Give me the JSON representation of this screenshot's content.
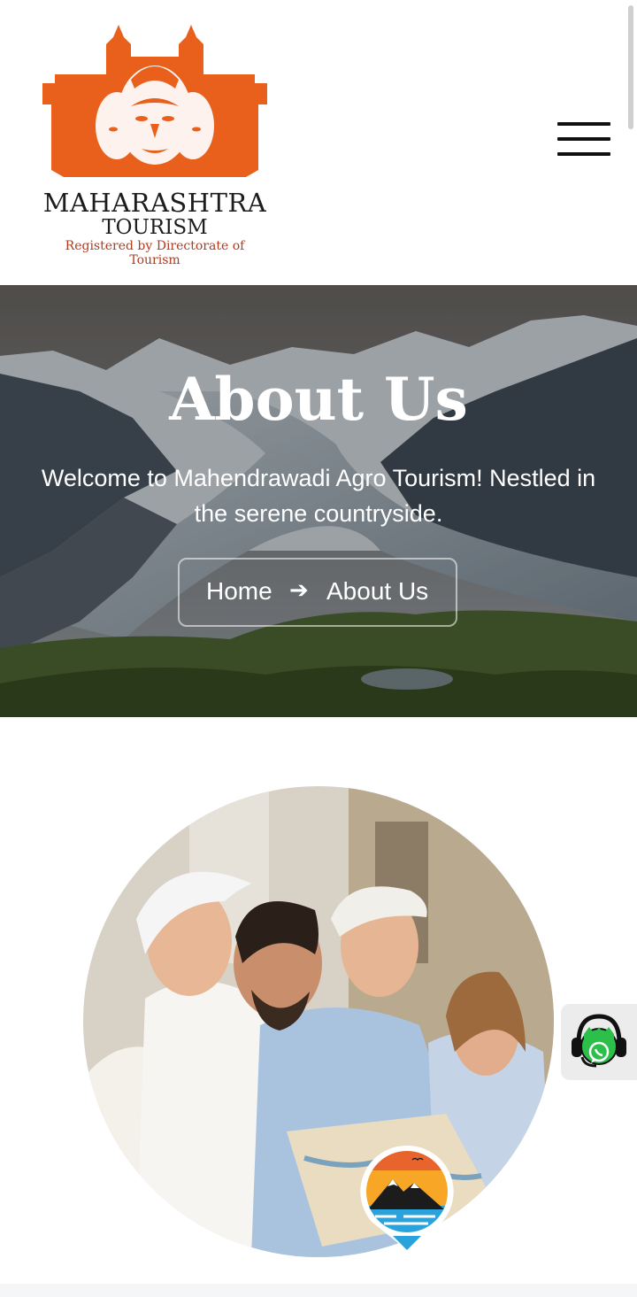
{
  "logo": {
    "name": "MAHARASHTRA",
    "subname": "TOURISM",
    "tagline": "Registered by Directorate of Tourism"
  },
  "menu": {
    "icon": "hamburger-menu-icon"
  },
  "hero": {
    "title": "About Us",
    "subtitle": "Welcome to Mahendrawadi Agro Tourism! Nestled in the serene countryside.",
    "breadcrumb": {
      "home": "Home",
      "separator_icon": "arrow-right-icon",
      "current": "About Us"
    }
  },
  "photo": {
    "subject": "group-of-travelers-image",
    "badge_icon": "mountain-pin-icon"
  },
  "whatsapp": {
    "icon": "whatsapp-support-icon"
  },
  "colors": {
    "brand_orange": "#e8601c",
    "text_dark": "#1d1d1d",
    "whatsapp_green": "#25d366"
  }
}
